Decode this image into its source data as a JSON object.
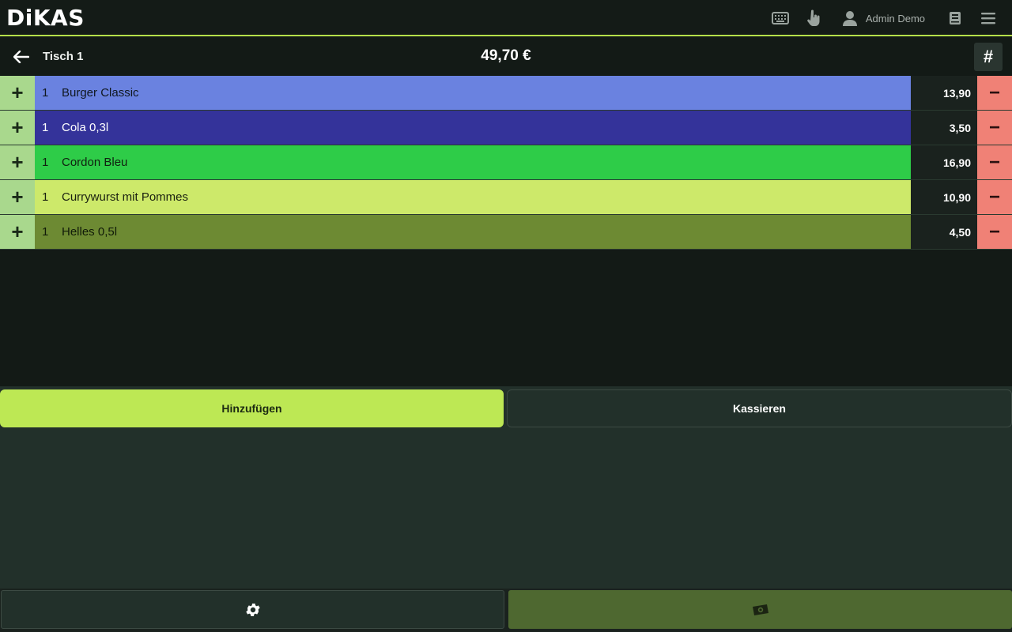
{
  "app": {
    "logo": "DiKAS",
    "user_name": "Admin Demo"
  },
  "icons": {
    "keyboard": "keyboard-icon",
    "touch": "hand-pointer-icon",
    "user": "user-icon",
    "book": "book-icon",
    "menu": "menu-icon",
    "back": "arrow-left-icon",
    "settings": "gear-icon",
    "cash": "money-bill-icon"
  },
  "header": {
    "table_name": "Tisch 1",
    "total": "49,70 €",
    "hash_label": "#"
  },
  "items": [
    {
      "qty": "1",
      "name": "Burger Classic",
      "price": "13,90",
      "color": "#6a82e0",
      "text_color": "#101820"
    },
    {
      "qty": "1",
      "name": "Cola 0,3l",
      "price": "3,50",
      "color": "#34339a",
      "text_color": "#ffffff"
    },
    {
      "qty": "1",
      "name": "Cordon Bleu",
      "price": "16,90",
      "color": "#2ecc48",
      "text_color": "#102010"
    },
    {
      "qty": "1",
      "name": "Currywurst mit Pommes",
      "price": "10,90",
      "color": "#cde96a",
      "text_color": "#1a2010"
    },
    {
      "qty": "1",
      "name": "Helles 0,5l",
      "price": "4,50",
      "color": "#6d8a33",
      "text_color": "#101a08"
    }
  ],
  "controls": {
    "plus": "+",
    "minus": "−"
  },
  "actions": {
    "add_label": "Hinzufügen",
    "pay_label": "Kassieren"
  },
  "colors": {
    "accent": "#bde854",
    "remove": "#f08176",
    "add": "#a9d88d"
  }
}
